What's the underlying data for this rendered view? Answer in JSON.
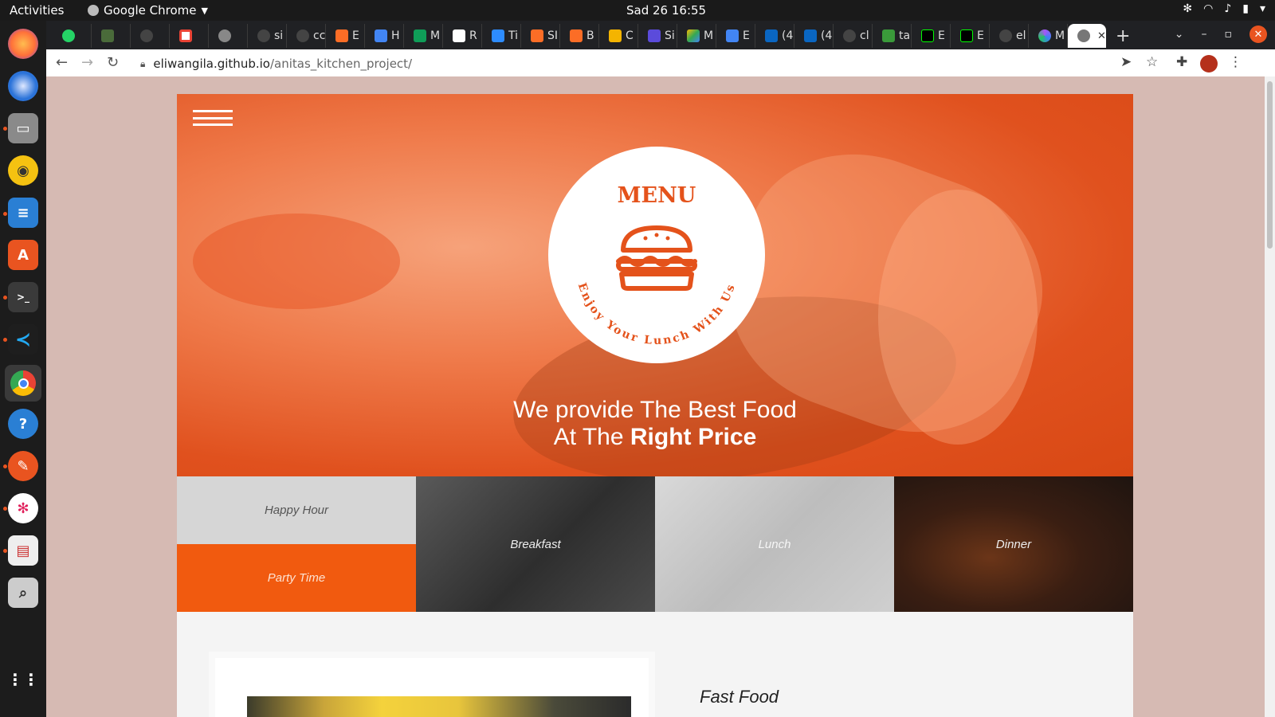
{
  "topbar": {
    "activities": "Activities",
    "app_name": "Google Chrome",
    "clock": "Sad 26  16:55"
  },
  "dock": {
    "items": [
      "firefox-icon",
      "thunderbird-icon",
      "files-icon",
      "rhythmbox-icon",
      "writer-icon",
      "software-icon",
      "terminal-icon",
      "vscode-icon",
      "chrome-icon",
      "help-icon",
      "inkscape-icon",
      "slack-icon",
      "document-viewer-icon",
      "magnifier-icon",
      "apps-grid-icon"
    ]
  },
  "browser": {
    "tabs": [
      {
        "label": "",
        "icon": "whatsapp-icon",
        "color": "#25d366"
      },
      {
        "label": "",
        "icon": "plant-icon",
        "color": "#4a6b3a"
      },
      {
        "label": "",
        "icon": "github-icon",
        "color": "#444444"
      },
      {
        "label": "",
        "icon": "google-icon",
        "color": "#ffffff"
      },
      {
        "label": "",
        "icon": "globe-icon",
        "color": "#888888"
      },
      {
        "label": "si",
        "icon": "github-icon",
        "color": "#444444"
      },
      {
        "label": "cc",
        "icon": "github-icon",
        "color": "#444444"
      },
      {
        "label": "E",
        "icon": "gitlab-icon",
        "color": "#fc6d26"
      },
      {
        "label": "H",
        "icon": "docs-icon",
        "color": "#4285f4"
      },
      {
        "label": "M",
        "icon": "sheets-icon",
        "color": "#0f9d58"
      },
      {
        "label": "R",
        "icon": "code-icon",
        "color": "#ffffff"
      },
      {
        "label": "Ti",
        "icon": "zoom-icon",
        "color": "#2d8cff"
      },
      {
        "label": "SI",
        "icon": "gitlab-icon",
        "color": "#fc6d26"
      },
      {
        "label": "B",
        "icon": "gitlab-icon",
        "color": "#fc6d26"
      },
      {
        "label": "C",
        "icon": "slides-icon",
        "color": "#f4b400"
      },
      {
        "label": "Si",
        "icon": "cube-icon",
        "color": "#5b4bdb"
      },
      {
        "label": "M",
        "icon": "drive-icon",
        "color": "#34a853"
      },
      {
        "label": "E",
        "icon": "docs-icon",
        "color": "#4285f4"
      },
      {
        "label": "(4",
        "icon": "linkedin-icon",
        "color": "#0a66c2"
      },
      {
        "label": "(4",
        "icon": "linkedin-icon",
        "color": "#0a66c2"
      },
      {
        "label": "cl",
        "icon": "github-icon",
        "color": "#444444"
      },
      {
        "label": "ta",
        "icon": "feather-icon",
        "color": "#3a9a3a"
      },
      {
        "label": "E",
        "icon": "ca-icon",
        "color": "#000000"
      },
      {
        "label": "E",
        "icon": "ca-icon",
        "color": "#000000"
      },
      {
        "label": "el",
        "icon": "github-icon",
        "color": "#444444"
      },
      {
        "label": "M",
        "icon": "colorful-icon",
        "color": "#a855f7"
      }
    ],
    "active_tab": {
      "icon": "globe-icon"
    },
    "url_host": "eliwangila.github.io",
    "url_path": "/anitas_kitchen_project/"
  },
  "site": {
    "badge": {
      "title": "MENU",
      "arc_text": "Enjoy Your Lunch With Us",
      "icon": "burger-icon"
    },
    "tagline_line1": "We provide The Best Food",
    "tagline_line2_plain": "At The ",
    "tagline_line2_bold": "Right Price",
    "tiles": {
      "happy_hour": "Happy Hour",
      "party_time": "Party Time",
      "breakfast": "Breakfast",
      "lunch": "Lunch",
      "dinner": "Dinner"
    },
    "section_title": "Fast Food",
    "accent_color": "#f15a0f"
  }
}
